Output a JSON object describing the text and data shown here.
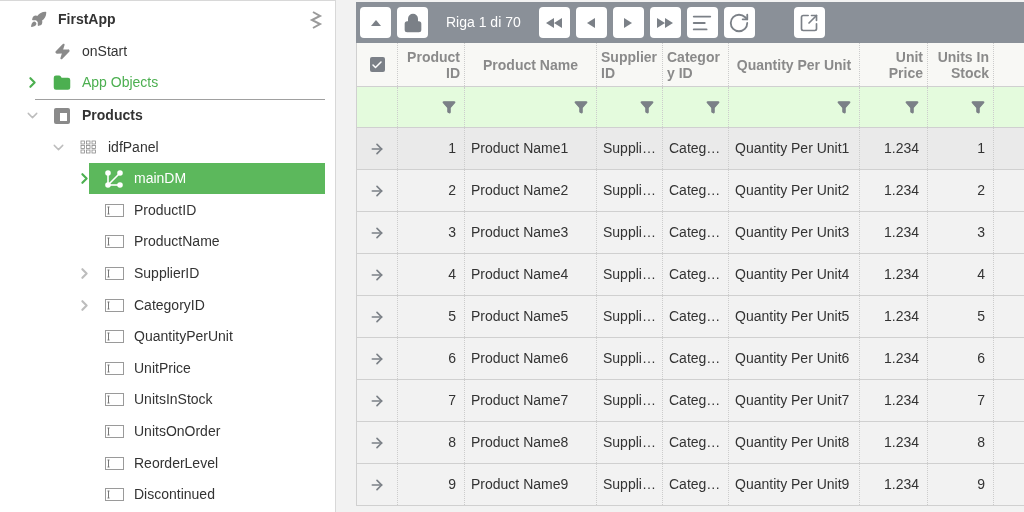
{
  "tree": [
    {
      "label": "FirstApp",
      "kind": "app",
      "selected": false,
      "highlighted": false,
      "children": [
        {
          "label": "onStart",
          "kind": "event",
          "selected": false,
          "highlighted": false
        },
        {
          "label": "App Objects",
          "kind": "folder",
          "selected": false,
          "highlighted": true,
          "expanded": false
        },
        {
          "label": "Products",
          "kind": "form",
          "selected": false,
          "highlighted": false,
          "expanded": true,
          "children": [
            {
              "label": "idfPanel",
              "kind": "panel",
              "selected": false,
              "highlighted": false,
              "expanded": true,
              "children": [
                {
                  "label": "mainDM",
                  "kind": "datamap",
                  "selected": true,
                  "highlighted": false,
                  "expanded": false
                },
                {
                  "label": "ProductID",
                  "kind": "field",
                  "selected": false,
                  "highlighted": false
                },
                {
                  "label": "ProductName",
                  "kind": "field",
                  "selected": false,
                  "highlighted": false
                },
                {
                  "label": "SupplierID",
                  "kind": "field",
                  "selected": false,
                  "highlighted": false,
                  "expanded": false
                },
                {
                  "label": "CategoryID",
                  "kind": "field",
                  "selected": false,
                  "highlighted": false,
                  "expanded": false
                },
                {
                  "label": "QuantityPerUnit",
                  "kind": "field",
                  "selected": false,
                  "highlighted": false
                },
                {
                  "label": "UnitPrice",
                  "kind": "field",
                  "selected": false,
                  "highlighted": false
                },
                {
                  "label": "UnitsInStock",
                  "kind": "field",
                  "selected": false,
                  "highlighted": false
                },
                {
                  "label": "UnitsOnOrder",
                  "kind": "field",
                  "selected": false,
                  "highlighted": false
                },
                {
                  "label": "ReorderLevel",
                  "kind": "field",
                  "selected": false,
                  "highlighted": false
                },
                {
                  "label": "Discontinued",
                  "kind": "field",
                  "selected": false,
                  "highlighted": false
                }
              ]
            }
          ]
        }
      ]
    }
  ],
  "toolbar": {
    "buttons_left": [
      {
        "kind": "up"
      },
      {
        "kind": "lock"
      }
    ],
    "status": "Riga 1 di 70",
    "buttons_right": [
      {
        "kind": "first"
      },
      {
        "kind": "prev"
      },
      {
        "kind": "next"
      },
      {
        "kind": "last"
      },
      {
        "kind": "list"
      },
      {
        "kind": "refresh"
      }
    ],
    "buttons_far": [
      {
        "kind": "external"
      }
    ]
  },
  "table": {
    "select_all": {
      "checked": true
    },
    "columns": [
      {
        "lines": [
          "Product",
          "ID"
        ]
      },
      {
        "lines": [
          "Product Name"
        ]
      },
      {
        "lines": [
          "Supplier",
          "ID"
        ]
      },
      {
        "lines": [
          "Categor",
          "y ID"
        ]
      },
      {
        "lines": [
          "Quantity Per Unit"
        ]
      },
      {
        "lines": [
          "Unit",
          "Price"
        ]
      },
      {
        "lines": [
          "Units In",
          "Stock"
        ]
      }
    ],
    "rows": [
      {
        "cells": [
          "1",
          "Product Name1",
          "Suppli…",
          "Categ…",
          "Quantity Per Unit1",
          "1.234",
          "1"
        ]
      },
      {
        "cells": [
          "2",
          "Product Name2",
          "Suppli…",
          "Categ…",
          "Quantity Per Unit2",
          "1.234",
          "2"
        ]
      },
      {
        "cells": [
          "3",
          "Product Name3",
          "Suppli…",
          "Categ…",
          "Quantity Per Unit3",
          "1.234",
          "3"
        ]
      },
      {
        "cells": [
          "4",
          "Product Name4",
          "Suppli…",
          "Categ…",
          "Quantity Per Unit4",
          "1.234",
          "4"
        ]
      },
      {
        "cells": [
          "5",
          "Product Name5",
          "Suppli…",
          "Categ…",
          "Quantity Per Unit5",
          "1.234",
          "5"
        ]
      },
      {
        "cells": [
          "6",
          "Product Name6",
          "Suppli…",
          "Categ…",
          "Quantity Per Unit6",
          "1.234",
          "6"
        ]
      },
      {
        "cells": [
          "7",
          "Product Name7",
          "Suppli…",
          "Categ…",
          "Quantity Per Unit7",
          "1.234",
          "7"
        ]
      },
      {
        "cells": [
          "8",
          "Product Name8",
          "Suppli…",
          "Categ…",
          "Quantity Per Unit8",
          "1.234",
          "8"
        ]
      },
      {
        "cells": [
          "9",
          "Product Name9",
          "Suppli…",
          "Categ…",
          "Quantity Per Unit9",
          "1.234",
          "9"
        ]
      }
    ]
  }
}
